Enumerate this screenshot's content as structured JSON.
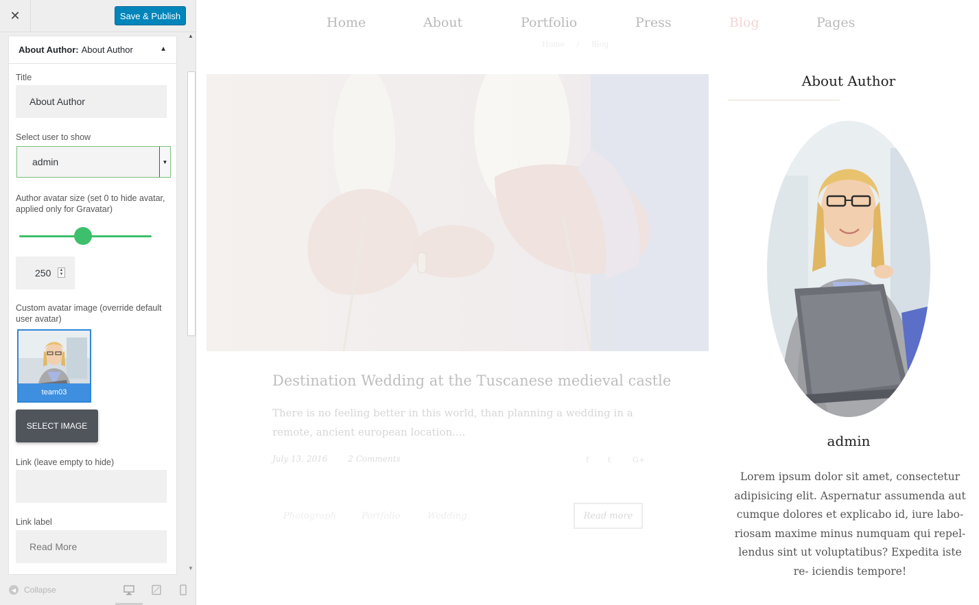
{
  "customizer": {
    "close_icon": "close-icon",
    "publish_label": "Save & Publish",
    "colors": {
      "publish": "#0085ba",
      "slider": "#3dbf6b",
      "select_border": "#7ac17a",
      "thumb_caption": "#3f8fe0"
    },
    "widget": {
      "header_prefix": "About Author:",
      "header_title": "About Author",
      "title_label": "Title",
      "title_value": "About Author",
      "user_label": "Select user to show",
      "user_value": "admin",
      "size_label": "Author avatar size (set 0 to hide avatar, applied only for Gravatar)",
      "size_value": "250",
      "size_slider_fraction": 0.48,
      "custom_avatar_label": "Custom avatar image (override default user avatar)",
      "image_caption": "team03",
      "select_image_label": "SELECT IMAGE",
      "link_label": "Link (leave empty to hide)",
      "link_value": "",
      "link_label_label": "Link label",
      "link_label_value": "Read More"
    },
    "footer": {
      "collapse_label": "Collapse"
    }
  },
  "preview": {
    "nav": [
      "Home",
      "About",
      "Portfolio",
      "Press",
      "Blog",
      "Pages"
    ],
    "nav_active": "Blog",
    "nav_active_color": "#f6d4d4",
    "breadcrumb": [
      "Home",
      "/",
      "Blog"
    ],
    "post": {
      "title": "Destination Wedding at the Tuscanese medieval castle",
      "excerpt": "There is no feeling better in this world, than planning a wedding in a remote, ancient european location....",
      "date": "July 13, 2016",
      "comments": "2 Comments",
      "share_icons": [
        "f",
        "t",
        "G+"
      ],
      "tags": [
        "Photograph",
        "Portfolio",
        "Wedding"
      ],
      "read_more": "Read more"
    },
    "sidebar": {
      "widget_title": "About Author",
      "author_name": "admin",
      "bio": "Lorem ipsum dolor sit amet, consectetur adipisicing elit. Aspernatur assumenda aut cumque dolores et explicabo id, iure labo- riosam maxime minus numquam qui repel- lendus sint ut voluptatibus? Expedita iste re- iciendis tempore!"
    }
  }
}
